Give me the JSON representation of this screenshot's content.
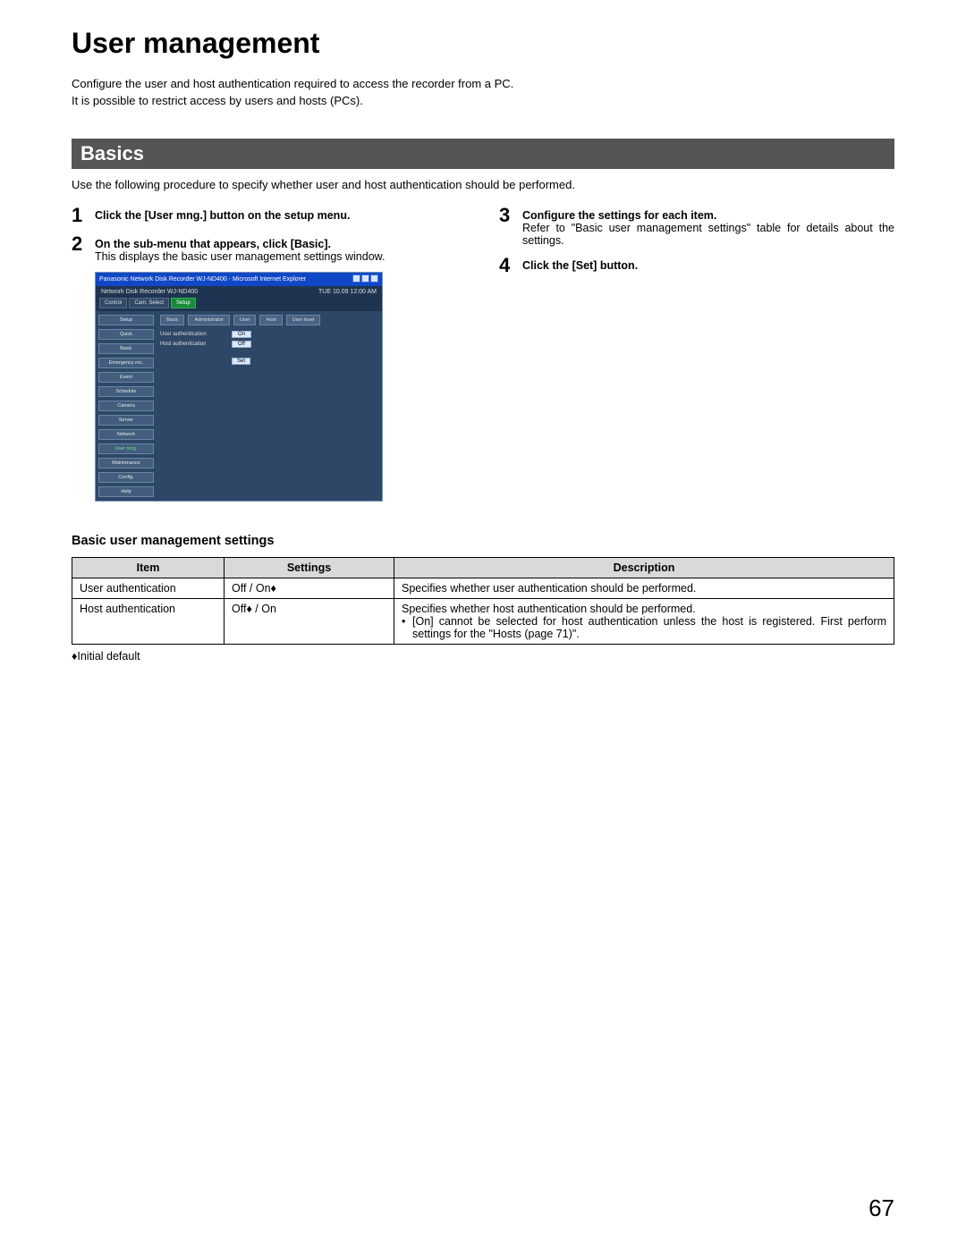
{
  "title": "User management",
  "intro_line1": "Configure the user and host authentication required to access the recorder from a PC.",
  "intro_line2": "It is possible to restrict access by users and hosts (PCs).",
  "section_heading": "Basics",
  "section_desc": "Use the following procedure to specify whether user and host authentication should be performed.",
  "steps": {
    "s1": {
      "num": "1",
      "text": "Click the [User mng.] button on the setup menu."
    },
    "s2": {
      "num": "2",
      "bold": "On the sub-menu that appears, click [Basic].",
      "plain": "This displays the basic user management settings window."
    },
    "s3": {
      "num": "3",
      "bold": "Configure the settings for each item.",
      "plain": "Refer to \"Basic user management settings\" table for details about the settings."
    },
    "s4": {
      "num": "4",
      "text": "Click the [Set] button."
    }
  },
  "screenshot": {
    "window_title": "Panasonic   Network Disk Recorder WJ-ND400 - Microsoft Internet Explorer",
    "brand": "Network Disk Recorder\nWJ-ND400",
    "clock": "TUE 10.09  12:00  AM",
    "top_tabs": [
      "Control",
      "Cam. Select",
      "Setup"
    ],
    "sub_tabs": [
      "Basic",
      "Administrator",
      "User",
      "Host",
      "User level"
    ],
    "side": [
      "Setup",
      "Quick",
      "Basic",
      "Emergency rec.",
      "Event",
      "Schedule",
      "Camera",
      "Server",
      "Network",
      "User mng.",
      "Maintenance",
      "Config.",
      "Help"
    ],
    "rows": [
      {
        "label": "User authentication",
        "value": "On"
      },
      {
        "label": "Host authentication",
        "value": "Off"
      }
    ],
    "set_button": "Set"
  },
  "settings_heading": "Basic user management settings",
  "table": {
    "headers": [
      "Item",
      "Settings",
      "Description"
    ],
    "rows": [
      {
        "item": "User authentication",
        "settings": "Off / On♦",
        "desc": "Specifies whether user authentication should be performed."
      },
      {
        "item": "Host authentication",
        "settings": "Off♦ / On",
        "desc_line": "Specifies whether host authentication should be performed.",
        "desc_bullet": "[On] cannot be selected for host authentication unless the host is registered. First perform settings for the \"Hosts (page 71)\"."
      }
    ]
  },
  "footnote": "♦Initial default",
  "page_number": "67"
}
